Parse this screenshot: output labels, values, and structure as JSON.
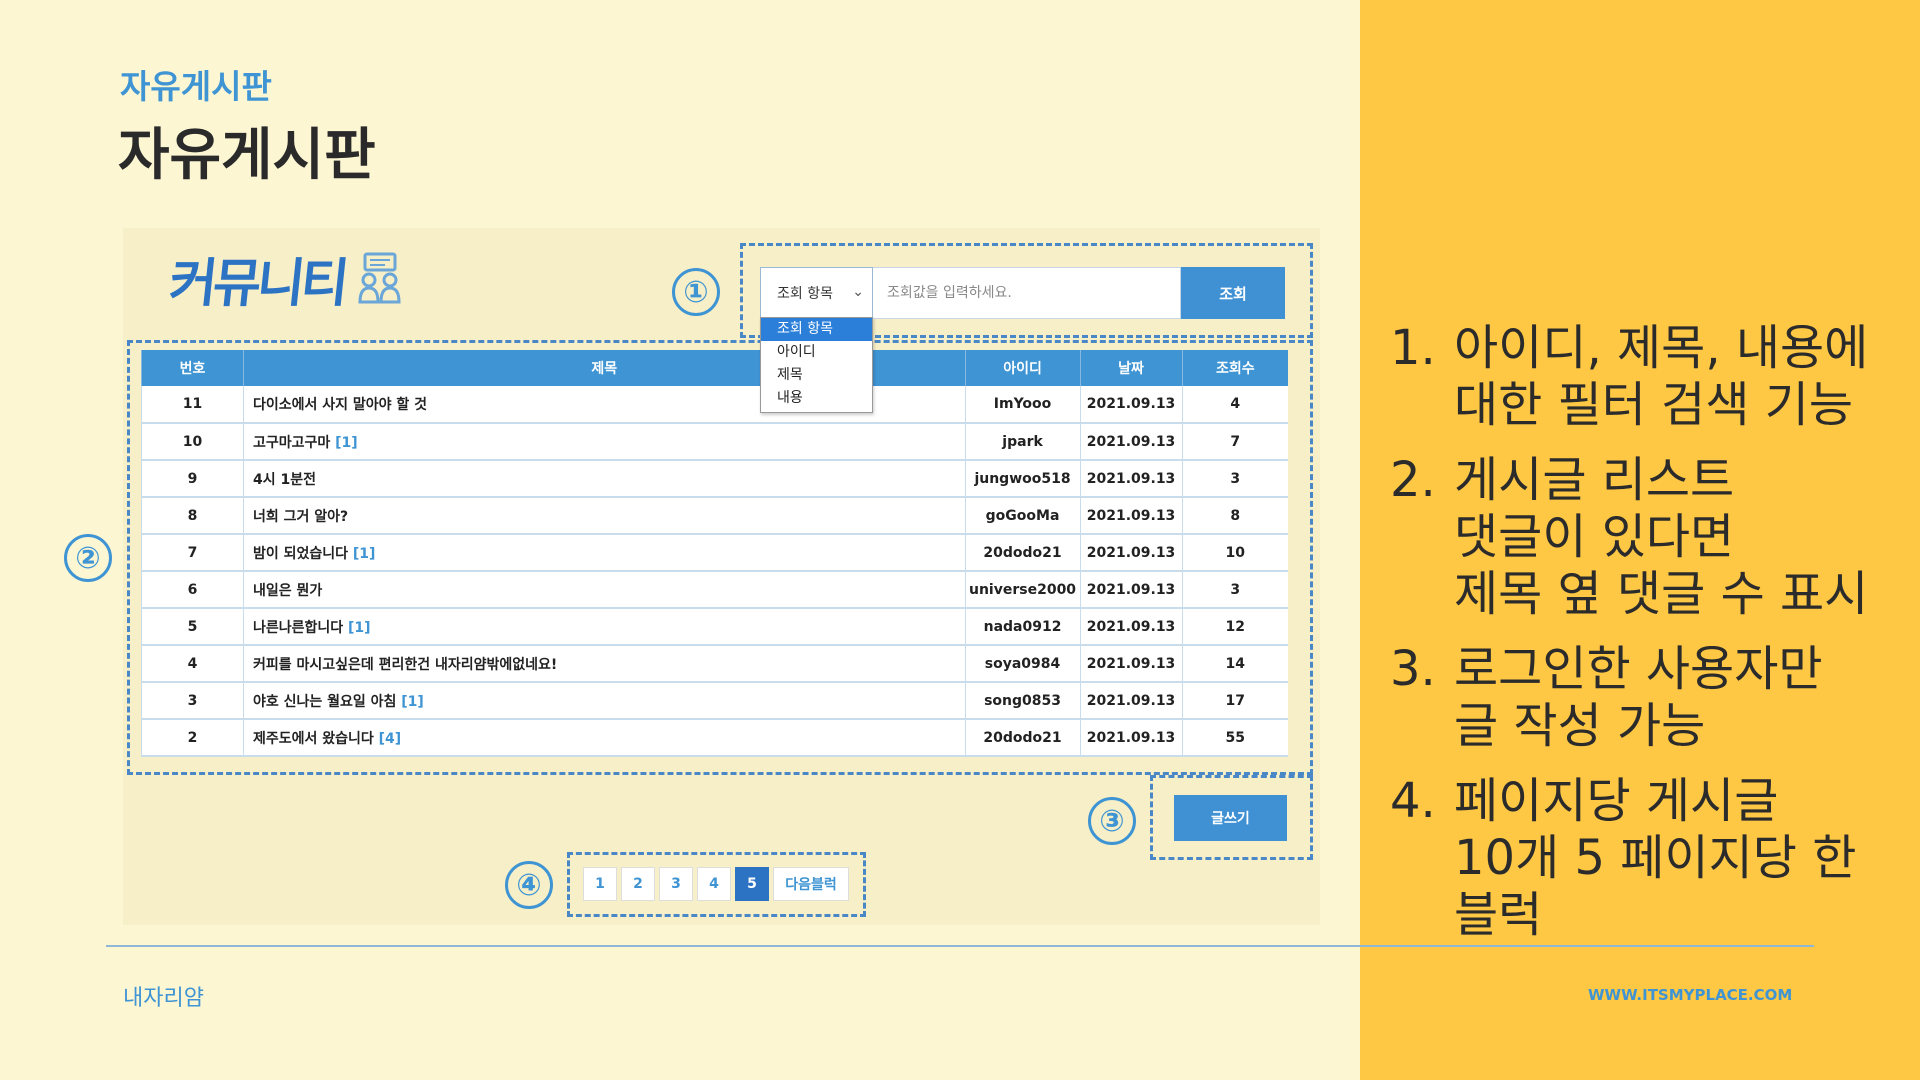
{
  "slide": {
    "subtitle": "자유게시판",
    "title": "자유게시판",
    "brand": "내자리얌",
    "url": "WWW.ITSMYPLACE.COM"
  },
  "app": {
    "logo_text": "커뮤니티",
    "search": {
      "selected": "조회 항목",
      "placeholder": "조회값을 입력하세요.",
      "button": "조회",
      "options": [
        "조회 항목",
        "아이디",
        "제목",
        "내용"
      ]
    },
    "table": {
      "headers": [
        "번호",
        "제목",
        "아이디",
        "날짜",
        "조회수"
      ],
      "rows": [
        {
          "no": "11",
          "title": "다이소에서 사지 말아야 할 것",
          "comments": "",
          "id": "ImYooo",
          "date": "2021.09.13",
          "views": "4"
        },
        {
          "no": "10",
          "title": "고구마고구마",
          "comments": "[1]",
          "id": "jpark",
          "date": "2021.09.13",
          "views": "7"
        },
        {
          "no": "9",
          "title": "4시 1분전",
          "comments": "",
          "id": "jungwoo518",
          "date": "2021.09.13",
          "views": "3"
        },
        {
          "no": "8",
          "title": "너희 그거 알아?",
          "comments": "",
          "id": "goGooMa",
          "date": "2021.09.13",
          "views": "8"
        },
        {
          "no": "7",
          "title": "밤이 되었습니다",
          "comments": "[1]",
          "id": "20dodo21",
          "date": "2021.09.13",
          "views": "10"
        },
        {
          "no": "6",
          "title": "내일은 뭔가",
          "comments": "",
          "id": "universe2000",
          "date": "2021.09.13",
          "views": "3"
        },
        {
          "no": "5",
          "title": "나른나른합니다",
          "comments": "[1]",
          "id": "nada0912",
          "date": "2021.09.13",
          "views": "12"
        },
        {
          "no": "4",
          "title": "커피를 마시고싶은데 편리한건 내자리얌밖에없네요!",
          "comments": "",
          "id": "soya0984",
          "date": "2021.09.13",
          "views": "14"
        },
        {
          "no": "3",
          "title": "야호 신나는 월요일 아침",
          "comments": "[1]",
          "id": "song0853",
          "date": "2021.09.13",
          "views": "17"
        },
        {
          "no": "2",
          "title": "제주도에서 왔습니다",
          "comments": "[4]",
          "id": "20dodo21",
          "date": "2021.09.13",
          "views": "55"
        }
      ]
    },
    "write_button": "글쓰기",
    "pagination": {
      "pages": [
        "1",
        "2",
        "3",
        "4",
        "5"
      ],
      "current": "5",
      "next": "다음블럭"
    }
  },
  "markers": [
    "①",
    "②",
    "③",
    "④"
  ],
  "features": [
    {
      "num": "1.",
      "text": "아이디, 제목, 내용에\n대한 필터 검색 기능"
    },
    {
      "num": "2.",
      "text": "게시글 리스트\n댓글이 있다면\n제목 옆 댓글 수 표시"
    },
    {
      "num": "3.",
      "text": "로그인한 사용자만\n글 작성 가능"
    },
    {
      "num": "4.",
      "text": "페이지당 게시글\n10개 5 페이지당 한\n블럭"
    }
  ],
  "colors": {
    "accent": "#3f94d3",
    "panel": "#fec744",
    "background": "#fcf6d3"
  }
}
